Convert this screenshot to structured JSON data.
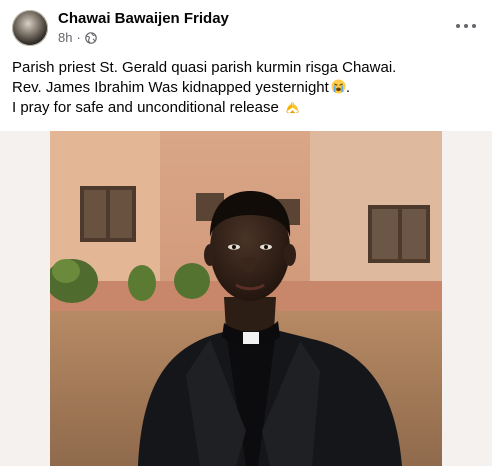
{
  "post": {
    "author": "Chawai Bawaijen Friday",
    "time": "8h",
    "separator": "·",
    "privacy_icon": "globe-icon",
    "more_icon": "more-options-icon",
    "caption": {
      "line1": "Parish priest St. Gerald quasi parish kurmin risga Chawai.",
      "line2": "Rev. James Ibrahim Was kidnapped yesternight",
      "line2_end": ".",
      "line3": "I pray for safe and unconditional release",
      "emoji1": "crying-face-emoji",
      "emoji2": "folded-hands-emoji"
    },
    "photo": {
      "subject": "priest-portrait-photo"
    }
  }
}
